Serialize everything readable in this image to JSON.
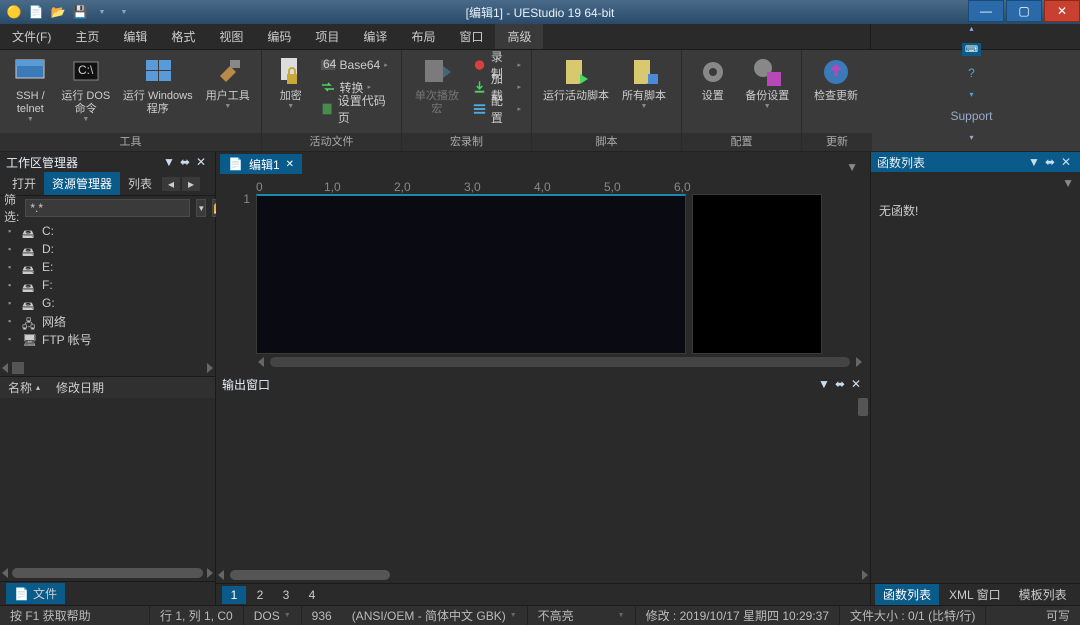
{
  "title": "[编辑1] - UEStudio 19 64-bit",
  "menu": {
    "items": [
      "文件(F)",
      "主页",
      "编辑",
      "格式",
      "视图",
      "编码",
      "项目",
      "编译",
      "布局",
      "窗口",
      "高级"
    ],
    "active": 10,
    "support": "Support"
  },
  "ribbon": {
    "groups": [
      {
        "label": "工具",
        "buttons": [
          {
            "id": "ssh",
            "lb": "SSH /\ntelnet"
          },
          {
            "id": "dos",
            "lb": "运行 DOS\n命令"
          },
          {
            "id": "runwin",
            "lb": "运行 Windows\n程序"
          },
          {
            "id": "usertool",
            "lb": "用户工具"
          }
        ]
      },
      {
        "label": "活动文件",
        "primary": {
          "id": "encrypt",
          "lb": "加密"
        },
        "minis": [
          {
            "id": "b64",
            "lb": "Base64"
          },
          {
            "id": "conv",
            "lb": "转换"
          },
          {
            "id": "codepage",
            "lb": "设置代码页"
          }
        ]
      },
      {
        "label": "宏录制",
        "primary": {
          "id": "playmacro",
          "lb": "单次播放宏",
          "disabled": true
        },
        "minis": [
          {
            "id": "rec",
            "lb": "录制"
          },
          {
            "id": "load",
            "lb": "加载"
          },
          {
            "id": "cfg",
            "lb": "配置"
          }
        ]
      },
      {
        "label": "脚本",
        "buttons": [
          {
            "id": "runactive",
            "lb": "运行活动脚本"
          },
          {
            "id": "allscripts",
            "lb": "所有脚本"
          }
        ]
      },
      {
        "label": "配置",
        "buttons": [
          {
            "id": "settings",
            "lb": "设置"
          },
          {
            "id": "backupset",
            "lb": "备份设置"
          }
        ]
      },
      {
        "label": "更新",
        "buttons": [
          {
            "id": "checkupd",
            "lb": "检查更新"
          }
        ]
      }
    ]
  },
  "sidebar": {
    "title": "工作区管理器",
    "tabs": [
      "打开",
      "资源管理器",
      "列表"
    ],
    "tab_on": 1,
    "filter_label": "筛选:",
    "filter_value": "*.*",
    "tree": [
      {
        "id": "c",
        "lb": "C:"
      },
      {
        "id": "d",
        "lb": "D:"
      },
      {
        "id": "e",
        "lb": "E:"
      },
      {
        "id": "f",
        "lb": "F:"
      },
      {
        "id": "g",
        "lb": "G:"
      },
      {
        "id": "net",
        "lb": "网络"
      },
      {
        "id": "ftp",
        "lb": "FTP 帐号"
      }
    ],
    "cols": {
      "name": "名称",
      "date": "修改日期"
    },
    "bottom": "文件"
  },
  "editor": {
    "tab": "编辑1",
    "line": "1",
    "ruler": [
      "0",
      "1,0",
      "2,0",
      "3,0",
      "4,0",
      "5,0",
      "6,0"
    ]
  },
  "output": {
    "title": "输出窗口",
    "tabs": [
      "1",
      "2",
      "3",
      "4"
    ],
    "tab_on": 0
  },
  "funcs": {
    "title": "函数列表",
    "empty": "无函数!",
    "tabs": [
      "函数列表",
      "XML 窗口",
      "模板列表"
    ],
    "tab_on": 0
  },
  "status": {
    "help": "按 F1 获取帮助",
    "pos": "行 1, 列 1, C0",
    "eol": "DOS",
    "cp": "936",
    "enc": "(ANSI/OEM - 简体中文 GBK)",
    "hl": "不高亮",
    "mod": "修改 :  2019/10/17 星期四 10:29:37",
    "size": "文件大小 :  0/1  (比特/行)",
    "mode": "可写"
  }
}
